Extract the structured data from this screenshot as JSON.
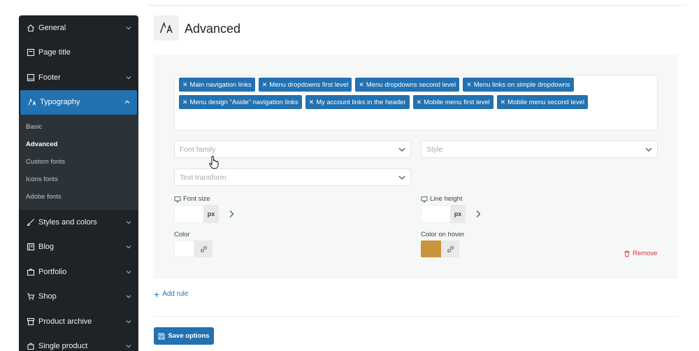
{
  "sidebar": {
    "items": [
      {
        "label": "General",
        "icon": "home-icon"
      },
      {
        "label": "Page title",
        "icon": "page-title-icon"
      },
      {
        "label": "Footer",
        "icon": "footer-icon"
      },
      {
        "label": "Typography",
        "icon": "typography-icon",
        "active": true
      },
      {
        "label": "Styles and colors",
        "icon": "brush-icon"
      },
      {
        "label": "Blog",
        "icon": "blog-icon"
      },
      {
        "label": "Portfolio",
        "icon": "portfolio-icon"
      },
      {
        "label": "Shop",
        "icon": "cart-icon"
      },
      {
        "label": "Product archive",
        "icon": "archive-icon"
      },
      {
        "label": "Single product",
        "icon": "product-icon"
      }
    ],
    "submenu": [
      "Basic",
      "Advanced",
      "Custom fonts",
      "Icons fonts",
      "Adobe fonts"
    ],
    "current_sub": "Advanced"
  },
  "page": {
    "title": "Advanced"
  },
  "tags": [
    "Main navigation links",
    "Menu dropdowns first level",
    "Menu dropdowns second level",
    "Menu links on simple dropdowns",
    "Menu design \"Aside\" navigation links",
    "My account links in the header",
    "Mobile menu first level",
    "Mobile menu second level"
  ],
  "form": {
    "font_family_placeholder": "Font family",
    "style_placeholder": "Style",
    "text_transform_placeholder": "Text transform",
    "font_size_label": "Font size",
    "line_height_label": "Line height",
    "unit": "px",
    "color_label": "Color",
    "color_hover_label": "Color on hover",
    "color_hover_value": "#c9953a",
    "remove_label": "Remove"
  },
  "actions": {
    "add_rule": "Add rule",
    "save": "Save options"
  },
  "colors": {
    "accent": "#2271b1",
    "sidebar_bg": "#1d2327",
    "danger": "#d63638"
  }
}
